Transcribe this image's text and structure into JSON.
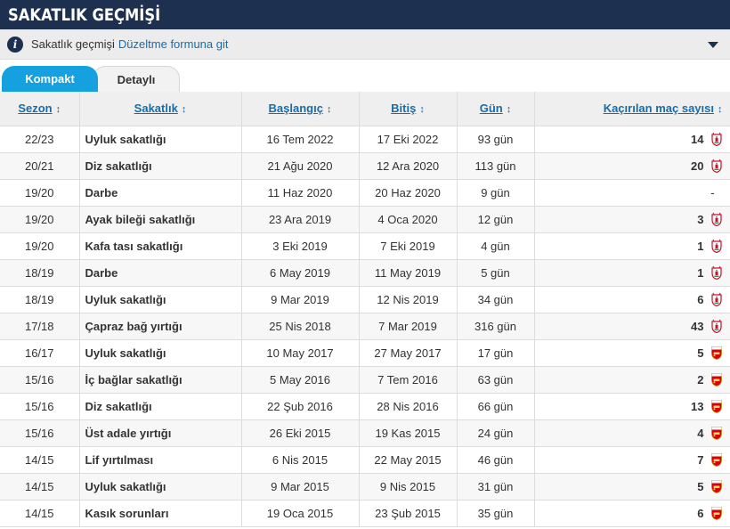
{
  "header": {
    "title": "SAKATLIK GEÇMİŞİ"
  },
  "info": {
    "text": "Sakatlık geçmişi",
    "link": "Düzeltme formuna git"
  },
  "tabs": [
    {
      "label": "Kompakt"
    },
    {
      "label": "Detaylı"
    }
  ],
  "columns": {
    "season": "Sezon",
    "injury": "Sakatlık",
    "start": "Başlangıç",
    "end": "Bitiş",
    "days": "Gün",
    "games": "Kaçırılan maç sayısı"
  },
  "colors": {
    "liverpool": "#c8102e",
    "arsenal": "#db0007",
    "accent": "#15a0df",
    "header": "#1d3050"
  },
  "rows": [
    {
      "season": "22/23",
      "injury": "Uyluk sakatlığı",
      "start": "16 Tem 2022",
      "end": "17 Eki 2022",
      "days": "93 gün",
      "games": "14",
      "club": "liverpool"
    },
    {
      "season": "20/21",
      "injury": "Diz sakatlığı",
      "start": "21 Ağu 2020",
      "end": "12 Ara 2020",
      "days": "113 gün",
      "games": "20",
      "club": "liverpool"
    },
    {
      "season": "19/20",
      "injury": "Darbe",
      "start": "11 Haz 2020",
      "end": "20 Haz 2020",
      "days": "9 gün",
      "games": "-",
      "club": ""
    },
    {
      "season": "19/20",
      "injury": "Ayak bileği sakatlığı",
      "start": "23 Ara 2019",
      "end": "4 Oca 2020",
      "days": "12 gün",
      "games": "3",
      "club": "liverpool"
    },
    {
      "season": "19/20",
      "injury": "Kafa tası sakatlığı",
      "start": "3 Eki 2019",
      "end": "7 Eki 2019",
      "days": "4 gün",
      "games": "1",
      "club": "liverpool"
    },
    {
      "season": "18/19",
      "injury": "Darbe",
      "start": "6 May 2019",
      "end": "11 May 2019",
      "days": "5 gün",
      "games": "1",
      "club": "liverpool"
    },
    {
      "season": "18/19",
      "injury": "Uyluk sakatlığı",
      "start": "9 Mar 2019",
      "end": "12 Nis 2019",
      "days": "34 gün",
      "games": "6",
      "club": "liverpool"
    },
    {
      "season": "17/18",
      "injury": "Çapraz bağ yırtığı",
      "start": "25 Nis 2018",
      "end": "7 Mar 2019",
      "days": "316 gün",
      "games": "43",
      "club": "liverpool"
    },
    {
      "season": "16/17",
      "injury": "Uyluk sakatlığı",
      "start": "10 May 2017",
      "end": "27 May 2017",
      "days": "17 gün",
      "games": "5",
      "club": "arsenal"
    },
    {
      "season": "15/16",
      "injury": "İç bağlar sakatlığı",
      "start": "5 May 2016",
      "end": "7 Tem 2016",
      "days": "63 gün",
      "games": "2",
      "club": "arsenal"
    },
    {
      "season": "15/16",
      "injury": "Diz sakatlığı",
      "start": "22 Şub 2016",
      "end": "28 Nis 2016",
      "days": "66 gün",
      "games": "13",
      "club": "arsenal"
    },
    {
      "season": "15/16",
      "injury": "Üst adale yırtığı",
      "start": "26 Eki 2015",
      "end": "19 Kas 2015",
      "days": "24 gün",
      "games": "4",
      "club": "arsenal"
    },
    {
      "season": "14/15",
      "injury": "Lif yırtılması",
      "start": "6 Nis 2015",
      "end": "22 May 2015",
      "days": "46 gün",
      "games": "7",
      "club": "arsenal"
    },
    {
      "season": "14/15",
      "injury": "Uyluk sakatlığı",
      "start": "9 Mar 2015",
      "end": "9 Nis 2015",
      "days": "31 gün",
      "games": "5",
      "club": "arsenal"
    },
    {
      "season": "14/15",
      "injury": "Kasık sorunları",
      "start": "19 Oca 2015",
      "end": "23 Şub 2015",
      "days": "35 gün",
      "games": "6",
      "club": "arsenal"
    }
  ]
}
